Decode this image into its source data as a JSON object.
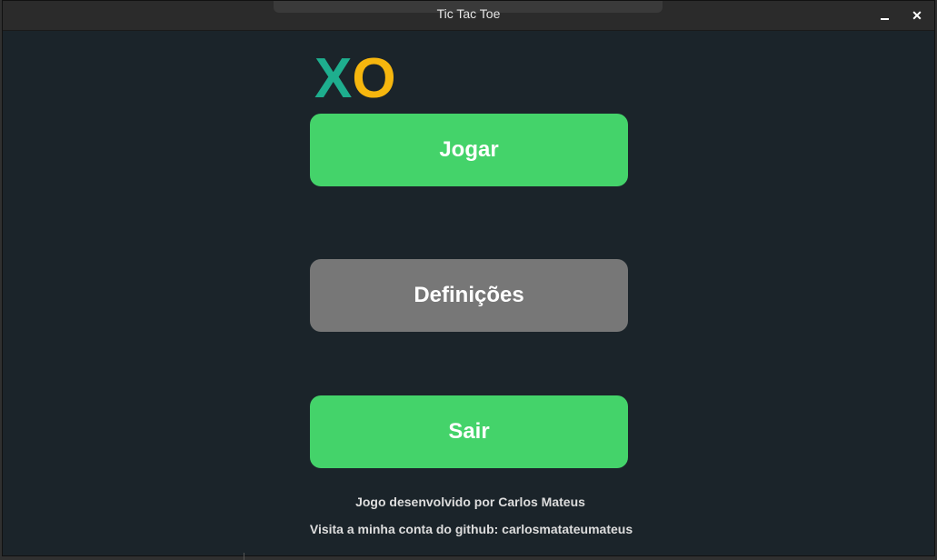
{
  "window": {
    "title": "Tic Tac Toe",
    "minimize_label": "",
    "close_label": "✕"
  },
  "logo": {
    "x": "X",
    "o": "O",
    "colors": {
      "x": "#1eae8e",
      "o": "#f6b60e"
    }
  },
  "menu": {
    "play_label": "Jogar",
    "settings_label": "Definições",
    "exit_label": "Sair",
    "colors": {
      "primary": "#44d36a",
      "secondary": "#777777"
    }
  },
  "footer": {
    "credit": "Jogo desenvolvido por Carlos Mateus",
    "github": "Visita a minha conta do github: carlosmatateumateus"
  }
}
